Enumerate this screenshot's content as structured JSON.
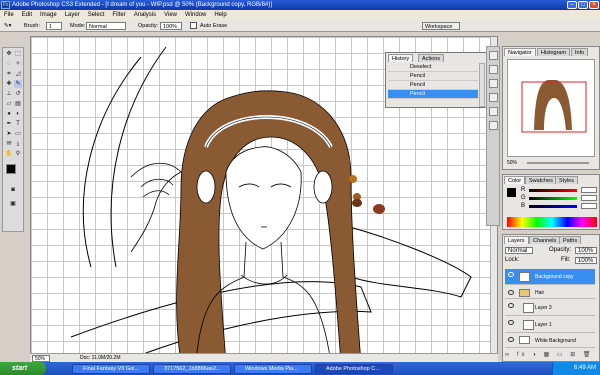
{
  "app": {
    "title": "Adobe Photoshop CS3 Extended - [I dream of you - WIP.psd @ 50% (Background copy, RGB/8#)]",
    "icon": "Ps"
  },
  "menu": [
    "File",
    "Edit",
    "Image",
    "Layer",
    "Select",
    "Filter",
    "Analysis",
    "View",
    "Window",
    "Help"
  ],
  "options": {
    "brush_label": "Brush:",
    "brush_size": "1",
    "mode_label": "Mode:",
    "mode_value": "Normal",
    "opacity_label": "Opacity:",
    "opacity_value": "100%",
    "auto_erase": "Auto Erase",
    "workspace": "Workspace"
  },
  "history": {
    "tabs": [
      "History",
      "Actions"
    ],
    "items": [
      "Deselect",
      "Pencil",
      "Pencil",
      "Pencil"
    ],
    "selected": 3
  },
  "navigator": {
    "tabs": [
      "Navigator",
      "Histogram",
      "Info"
    ],
    "zoom": "50%"
  },
  "color": {
    "tabs": [
      "Color",
      "Swatches",
      "Styles"
    ],
    "channels": [
      "R",
      "G",
      "B"
    ],
    "values": [
      "",
      "",
      ""
    ]
  },
  "layers": {
    "tabs": [
      "Layers",
      "Channels",
      "Paths"
    ],
    "blend": "Normal",
    "opacity_label": "Opacity:",
    "opacity": "100%",
    "fill_label": "Fill:",
    "fill": "100%",
    "lock_label": "Lock:",
    "items": [
      "Background copy",
      "Hair",
      "Layer 3",
      "Layer 1",
      "White Background"
    ],
    "selected": 0
  },
  "status": {
    "zoom": "50%",
    "doc": "Doc: 11.0M/20.2M"
  },
  "taskbar": {
    "start": "start",
    "tasks": [
      "Final Fantasy VII Gol...",
      "3717562_1b8886ee2...",
      "Windows Media Pla...",
      "Adobe Photoshop C..."
    ],
    "active": 3,
    "clock": "6:49 AM"
  },
  "colors": {
    "hair": "#8a5a32",
    "accent": "#3a8ef0",
    "titlebar": "#0a3aa8"
  },
  "swatches": [
    "#8a5a32",
    "#a05a20",
    "#b8741c",
    "#6a3418",
    "#8a3c20"
  ]
}
